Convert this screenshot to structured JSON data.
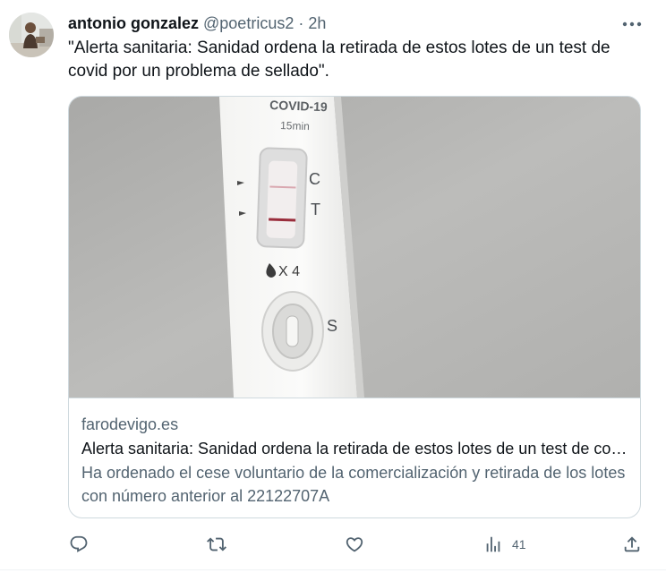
{
  "author": {
    "name": "antonio gonzalez",
    "handle": "@poetricus2",
    "separator": "·",
    "time": "2h",
    "avatar_icon": "user-avatar"
  },
  "tweet": {
    "text": "\"Alerta sanitaria: Sanidad ordena la retirada de estos lotes de un test de covid por un problema de sellado\"."
  },
  "card": {
    "domain": "farodevigo.es",
    "title": "Alerta sanitaria: Sanidad ordena la retirada de estos lotes de un test de covid por un problema de sellado",
    "description": "Ha ordenado el cese voluntario de la comercialización y retirada de los lotes con número anterior al 22122707A",
    "image": {
      "label_top": "COVID-19",
      "time_label": "15min",
      "c_label": "C",
      "t_label": "T",
      "drop_label": "X 4",
      "s_label": "S"
    }
  },
  "actions": {
    "reply_icon": "reply-icon",
    "retweet_icon": "retweet-icon",
    "like_icon": "heart-icon",
    "views_icon": "views-icon",
    "views_count": "41",
    "share_icon": "share-icon"
  },
  "colors": {
    "text_primary": "#0f1419",
    "text_secondary": "#536471",
    "border": "#cfd9de"
  }
}
